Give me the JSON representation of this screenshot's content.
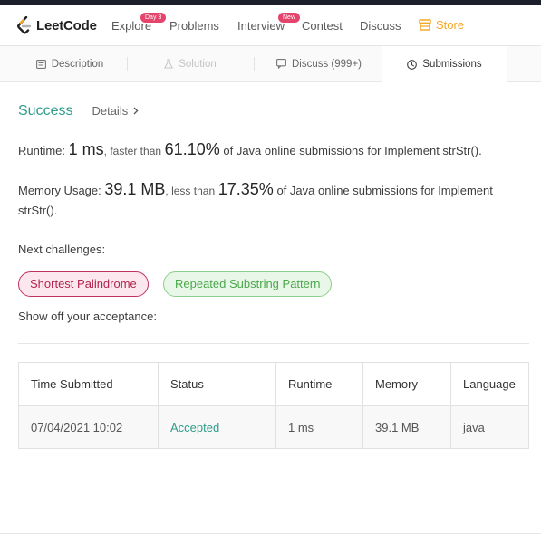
{
  "brand": {
    "name": "LeetCode",
    "accent": "#f5a623"
  },
  "nav": {
    "explore": "Explore",
    "explore_badge": "Day 3",
    "problems": "Problems",
    "interview": "Interview",
    "interview_badge": "New",
    "contest": "Contest",
    "discuss": "Discuss",
    "store": "Store"
  },
  "tabs": {
    "description": "Description",
    "solution": "Solution",
    "discuss": "Discuss (999+)",
    "submissions": "Submissions"
  },
  "result": {
    "status": "Success",
    "details": "Details",
    "status_color": "#2e9c8a"
  },
  "runtime": {
    "label": "Runtime:",
    "value": "1 ms",
    "faster_text": ", faster than",
    "percent": "61.10%",
    "suffix": "of Java online submissions for Implement strStr()."
  },
  "memory": {
    "label": "Memory Usage:",
    "value": "39.1 MB",
    "less_text": ", less than",
    "percent": "17.35%",
    "suffix": "of Java online submissions for Implement strStr()."
  },
  "next": {
    "label": "Next challenges:",
    "challenges": [
      {
        "label": "Shortest Palindrome",
        "difficulty": "hard"
      },
      {
        "label": "Repeated Substring Pattern",
        "difficulty": "easy"
      }
    ]
  },
  "showoff": "Show off your acceptance:",
  "table": {
    "headers": [
      "Time Submitted",
      "Status",
      "Runtime",
      "Memory",
      "Language"
    ],
    "rows": [
      [
        "07/04/2021 10:02",
        "Accepted",
        "1 ms",
        "39.1 MB",
        "java"
      ]
    ]
  }
}
